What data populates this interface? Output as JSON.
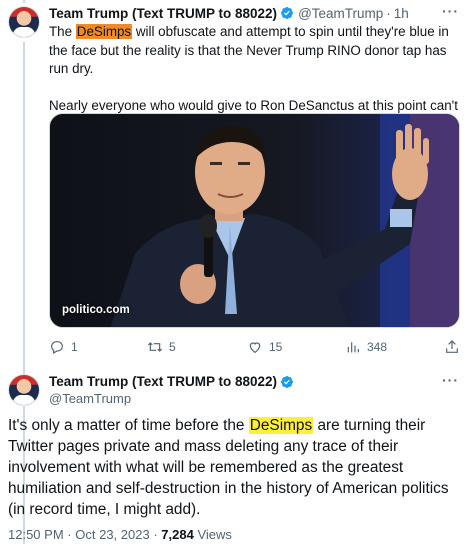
{
  "tweet1": {
    "display_name": "Team Trump (Text TRUMP to 88022)",
    "handle": "@TeamTrump",
    "separator": "·",
    "time": "1h",
    "text_pre": "The ",
    "highlight": "DeSimps",
    "text_post": " will obfuscate and attempt to spin until they're blue in the face but the reality is that the Never Trump RINO donor tap has run dry.",
    "text_para2": "Nearly everyone who would give to Ron DeSanctus at this point can't give again.",
    "media_source": "politico.com",
    "highlight_color": "#f08a24",
    "actions": {
      "reply_count": "1",
      "retweet_count": "5",
      "like_count": "15",
      "views_count": "348"
    }
  },
  "tweet2": {
    "display_name": "Team Trump (Text TRUMP to 88022)",
    "handle": "@TeamTrump",
    "text_pre": "It's only a matter of time before the ",
    "highlight": "DeSimps",
    "text_post": " are turning their Twitter pages private and mass deleting any trace of their involvement with what will be remembered as the greatest humiliation and self-destruction in the history of American politics (in record time, I might add).",
    "highlight_color": "#ffef3a",
    "time": "12:50 PM",
    "separator1": "·",
    "date": "Oct 23, 2023",
    "separator2": "·",
    "views_count": "7,284",
    "views_label": " Views"
  },
  "colors": {
    "verified": "#1d9bf0",
    "secondary_text": "#536471",
    "primary_text": "#0f1419"
  }
}
